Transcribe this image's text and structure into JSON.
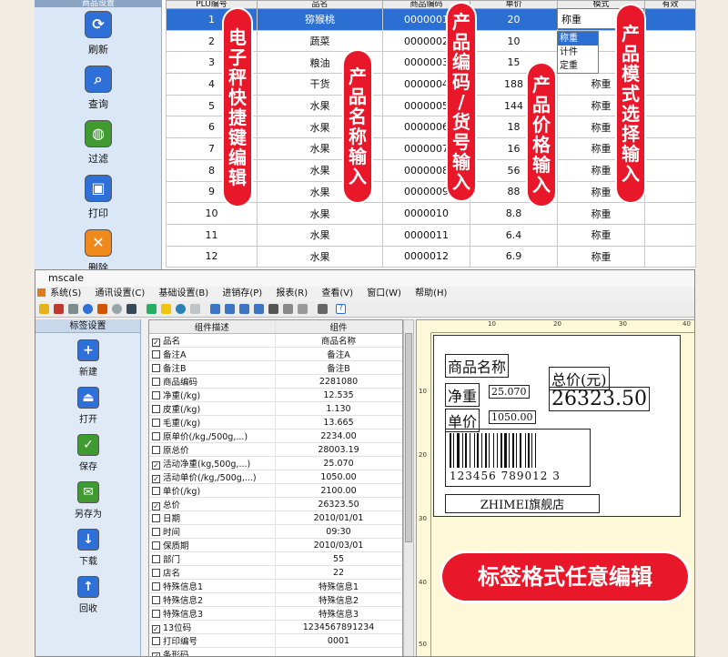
{
  "top_panel": {
    "sidebar_title": "商品设置",
    "sidebar_buttons": [
      {
        "label": "刷新",
        "icon": "refresh-icon",
        "color": "#2f6fd8"
      },
      {
        "label": "查询",
        "icon": "magnifier-icon",
        "color": "#2f6fd8"
      },
      {
        "label": "过滤",
        "icon": "globe-icon",
        "color": "#3f9a2f"
      },
      {
        "label": "打印",
        "icon": "printer-icon",
        "color": "#2f6fd8"
      },
      {
        "label": "删除",
        "icon": "delete-icon",
        "color": "#f08a1c"
      }
    ],
    "columns": [
      "PLU编号",
      "品名",
      "商品编码",
      "单价",
      "模式",
      "有效"
    ],
    "rows": [
      {
        "no": "1",
        "name": "猕猴桃",
        "code": "0000001",
        "price": "20",
        "mode": "称重"
      },
      {
        "no": "2",
        "name": "蔬菜",
        "code": "0000002",
        "price": "10",
        "mode": ""
      },
      {
        "no": "3",
        "name": "粮油",
        "code": "0000003",
        "price": "15",
        "mode": ""
      },
      {
        "no": "4",
        "name": "干货",
        "code": "0000004",
        "price": "188",
        "mode": "称重"
      },
      {
        "no": "5",
        "name": "水果",
        "code": "0000005",
        "price": "144",
        "mode": "称重"
      },
      {
        "no": "6",
        "name": "水果",
        "code": "0000006",
        "price": "18",
        "mode": "称重"
      },
      {
        "no": "7",
        "name": "水果",
        "code": "0000007",
        "price": "16",
        "mode": "称重"
      },
      {
        "no": "8",
        "name": "水果",
        "code": "0000008",
        "price": "56",
        "mode": "称重"
      },
      {
        "no": "9",
        "name": "水果",
        "code": "0000009",
        "price": "88",
        "mode": "称重"
      },
      {
        "no": "10",
        "name": "水果",
        "code": "0000010",
        "price": "8.8",
        "mode": "称重"
      },
      {
        "no": "11",
        "name": "水果",
        "code": "0000011",
        "price": "6.4",
        "mode": "称重"
      },
      {
        "no": "12",
        "name": "水果",
        "code": "0000012",
        "price": "6.9",
        "mode": "称重"
      }
    ],
    "mode_dropdown": {
      "selected": "称重",
      "options": [
        "称重",
        "计件",
        "定重"
      ]
    },
    "callouts": {
      "scale_edit": [
        "电",
        "子",
        "秤",
        "快",
        "捷",
        "键",
        "编",
        "辑"
      ],
      "name_input": [
        "产",
        "品",
        "名",
        "称",
        "输",
        "入"
      ],
      "code_input": [
        "产",
        "品",
        "编",
        "码",
        "/",
        "货",
        "号",
        "输",
        "入"
      ],
      "price_input": [
        "产",
        "品",
        "价",
        "格",
        "输",
        "入"
      ],
      "mode_input": [
        "产",
        "品",
        "模",
        "式",
        "选",
        "择",
        "输",
        "入"
      ]
    },
    "accent": "#e8182a",
    "selection": "#2b6fd3"
  },
  "app": {
    "title": "mscale",
    "menu": [
      "系统(S)",
      "通讯设置(C)",
      "基础设置(B)",
      "进销存(P)",
      "报表(R)",
      "查看(V)",
      "窗口(W)",
      "帮助(H)"
    ],
    "sidebar_title": "标签设置",
    "sidebar_buttons": [
      {
        "label": "新建",
        "icon": "plus-icon",
        "color": "#2f6fd8"
      },
      {
        "label": "打开",
        "icon": "eject-icon",
        "color": "#2f6fd8"
      },
      {
        "label": "保存",
        "icon": "check-icon",
        "color": "#3f9a2f"
      },
      {
        "label": "另存为",
        "icon": "envelope-icon",
        "color": "#3f9a2f"
      },
      {
        "label": "下载",
        "icon": "arrow-down-icon",
        "color": "#2f6fd8"
      },
      {
        "label": "回收",
        "icon": "arrow-up-icon",
        "color": "#2f6fd8"
      }
    ],
    "props_columns": [
      "组件描述",
      "组件"
    ],
    "props": [
      {
        "checked": true,
        "desc": "品名",
        "value": "商品名称"
      },
      {
        "checked": false,
        "desc": "备注A",
        "value": "备注A"
      },
      {
        "checked": false,
        "desc": "备注B",
        "value": "备注B"
      },
      {
        "checked": false,
        "desc": "商品编码",
        "value": "2281080"
      },
      {
        "checked": false,
        "desc": "净重(/kg)",
        "value": "12.535"
      },
      {
        "checked": false,
        "desc": "皮重(/kg)",
        "value": "1.130"
      },
      {
        "checked": false,
        "desc": "毛重(/kg)",
        "value": "13.665"
      },
      {
        "checked": false,
        "desc": "原单价(/kg,/500g,...)",
        "value": "2234.00"
      },
      {
        "checked": false,
        "desc": "原总价",
        "value": "28003.19"
      },
      {
        "checked": true,
        "desc": "活动净重(kg,500g,...)",
        "value": "25.070"
      },
      {
        "checked": true,
        "desc": "活动单价(/kg,/500g,...)",
        "value": "1050.00"
      },
      {
        "checked": false,
        "desc": "单价(/kg)",
        "value": "2100.00"
      },
      {
        "checked": true,
        "desc": "总价",
        "value": "26323.50"
      },
      {
        "checked": false,
        "desc": "日期",
        "value": "2010/01/01"
      },
      {
        "checked": false,
        "desc": "时间",
        "value": "09:30"
      },
      {
        "checked": false,
        "desc": "保质期",
        "value": "2010/03/01"
      },
      {
        "checked": false,
        "desc": "部门",
        "value": "55"
      },
      {
        "checked": false,
        "desc": "店名",
        "value": "22"
      },
      {
        "checked": false,
        "desc": "特殊信息1",
        "value": "特殊信息1"
      },
      {
        "checked": false,
        "desc": "特殊信息2",
        "value": "特殊信息2"
      },
      {
        "checked": false,
        "desc": "特殊信息3",
        "value": "特殊信息3"
      },
      {
        "checked": true,
        "desc": "13位码",
        "value": "1234567891234"
      },
      {
        "checked": false,
        "desc": "打印编号",
        "value": "0001"
      },
      {
        "checked": true,
        "desc": "条形码",
        "value": ""
      }
    ],
    "ruler_h": [
      "10",
      "20",
      "30",
      "40"
    ],
    "ruler_v": [
      "10",
      "20",
      "30",
      "40",
      "50"
    ],
    "label": {
      "name_title": "商品名称",
      "total_title": "总价(元)",
      "weight_title": "净重",
      "weight_value": "25.070",
      "total_value": "26323.50",
      "price_title": "单价",
      "price_value": "1050.00",
      "barcode_digits": "123456 789012 3",
      "shop_name": "ZHIMEI旗舰店"
    },
    "edit_callout": "标签格式任意编辑"
  }
}
